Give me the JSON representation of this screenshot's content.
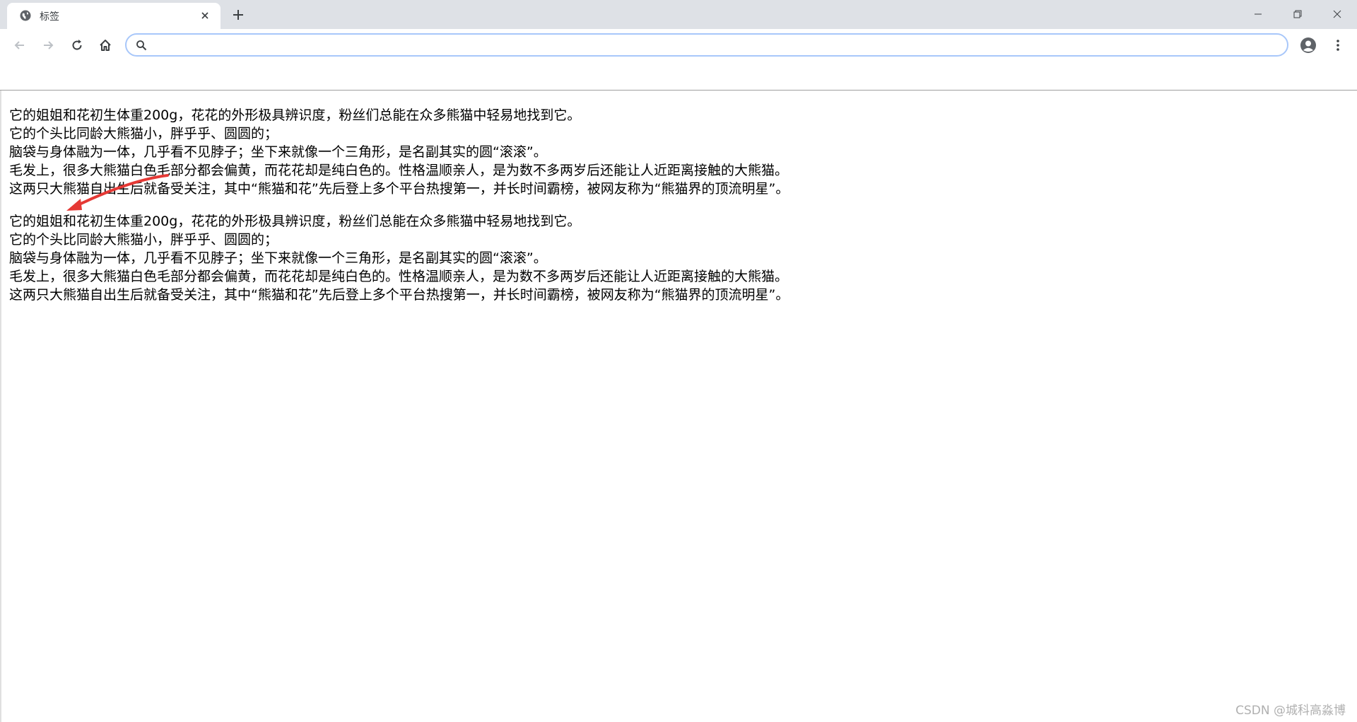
{
  "tab": {
    "title": "标签",
    "favicon": "globe-icon",
    "close_icon": "close-icon"
  },
  "new_tab_icon": "plus-icon",
  "window_controls": [
    "minimize-icon",
    "restore-icon",
    "close-icon"
  ],
  "toolbar": {
    "back_icon": "arrow-left-icon",
    "forward_icon": "arrow-right-icon",
    "reload_icon": "reload-icon",
    "home_icon": "home-icon",
    "omnibox_value": "",
    "profile_icon": "account-circle-icon",
    "menu_icon": "kebab-menu-icon"
  },
  "colors": {
    "tabstrip_bg": "#dee1e6",
    "omnibox_border": "#a8c7fa",
    "annotation_arrow": "#e53935"
  },
  "content": {
    "block1": {
      "line1": "它的姐姐和花初生体重200g，花花的外形极具辨识度，粉丝们总能在众多熊猫中轻易地找到它。",
      "line2": "它的个头比同龄大熊猫小，胖乎乎、圆圆的；",
      "line3": "脑袋与身体融为一体，几乎看不见脖子；坐下来就像一个三角形，是名副其实的圆“滚滚”。",
      "line4": "毛发上，很多大熊猫白色毛部分都会偏黄，而花花却是纯白色的。性格温顺亲人，是为数不多两岁后还能让人近距离接触的大熊猫。",
      "line5": "这两只大熊猫自出生后就备受关注，其中“熊猫和花”先后登上多个平台热搜第一，并长时间霸榜，被网友称为“熊猫界的顶流明星”。"
    },
    "block2": {
      "line1": "它的姐姐和花初生体重200g，花花的外形极具辨识度，粉丝们总能在众多熊猫中轻易地找到它。",
      "line2": "它的个头比同龄大熊猫小，胖乎乎、圆圆的；",
      "line3": "脑袋与身体融为一体，几乎看不见脖子；坐下来就像一个三角形，是名副其实的圆“滚滚”。",
      "line4": "毛发上，很多大熊猫白色毛部分都会偏黄，而花花却是纯白色的。性格温顺亲人，是为数不多两岁后还能让人近距离接触的大熊猫。",
      "line5": "这两只大熊猫自出生后就备受关注，其中“熊猫和花”先后登上多个平台热搜第一，并长时间霸榜，被网友称为“熊猫界的顶流明星”。"
    }
  },
  "watermark": "CSDN @城科高淼博"
}
